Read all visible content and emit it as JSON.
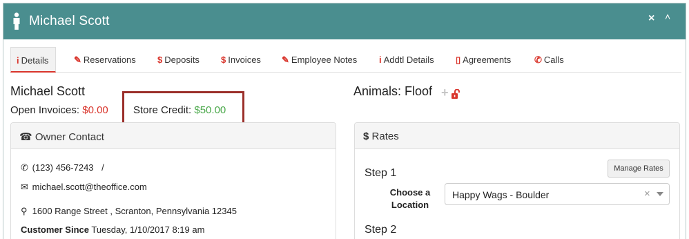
{
  "header": {
    "title": "Michael Scott",
    "close_glyph": "×",
    "collapse_glyph": "˄"
  },
  "tabs": [
    {
      "label": "Details",
      "icon": "info-icon",
      "glyph": "i"
    },
    {
      "label": "Reservations",
      "icon": "edit-icon",
      "glyph": "✎"
    },
    {
      "label": "Deposits",
      "icon": "dollar-icon",
      "glyph": "$"
    },
    {
      "label": "Invoices",
      "icon": "dollar-icon",
      "glyph": "$"
    },
    {
      "label": "Employee Notes",
      "icon": "pencil-icon",
      "glyph": "✎"
    },
    {
      "label": "Addtl Details",
      "icon": "info-icon",
      "glyph": "i"
    },
    {
      "label": "Agreements",
      "icon": "clipboard-icon",
      "glyph": "▯"
    },
    {
      "label": "Calls",
      "icon": "phone-icon",
      "glyph": "✆"
    }
  ],
  "owner": {
    "name": "Michael Scott",
    "open_invoices_label": "Open Invoices:",
    "open_invoices_amount": "$0.00",
    "store_credit_label": "Store Credit:",
    "store_credit_amount": "$50.00"
  },
  "animals": {
    "label": "Animals: Floof"
  },
  "owner_contact": {
    "heading": "Owner Contact",
    "phone": "(123) 456-7243",
    "phone_separator": "/",
    "email": "michael.scott@theoffice.com",
    "address": "1600 Range Street , Scranton, Pennsylvania 12345",
    "customer_since_label": "Customer Since",
    "customer_since_value": "Tuesday, 1/10/2017 8:19 am"
  },
  "rates": {
    "heading": "Rates",
    "step1": "Step 1",
    "manage_rates_label": "Manage Rates",
    "location_label": "Choose a Location",
    "location_value": "Happy Wags - Boulder",
    "step2": "Step 2"
  },
  "colors": {
    "header_bg": "#4a8e8f",
    "accent_red": "#d9342b",
    "credit_green": "#4aa84a",
    "highlight_box": "#9b2f2a"
  }
}
